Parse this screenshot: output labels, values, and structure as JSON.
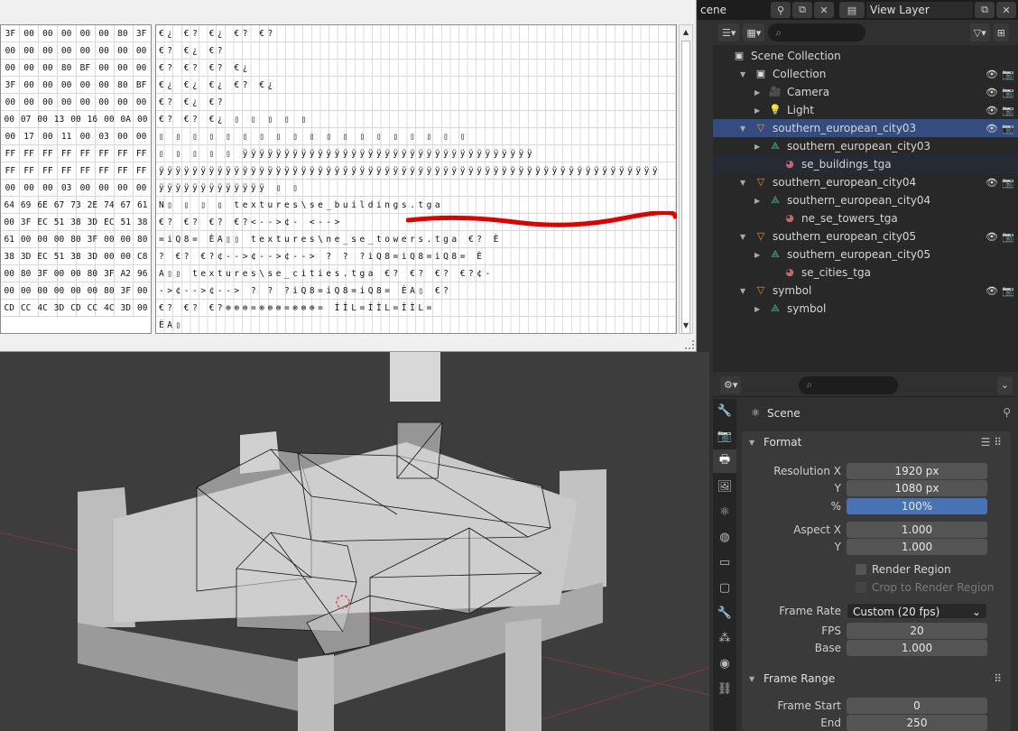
{
  "hex": {
    "byte_rows": [
      [
        "3F",
        "00",
        "00",
        "00",
        "00",
        "00",
        "80",
        "3F"
      ],
      [
        "00",
        "00",
        "00",
        "00",
        "00",
        "00",
        "00",
        "00"
      ],
      [
        "00",
        "00",
        "00",
        "80",
        "BF",
        "00",
        "00",
        "00"
      ],
      [
        "3F",
        "00",
        "00",
        "00",
        "00",
        "00",
        "80",
        "BF"
      ],
      [
        "00",
        "00",
        "00",
        "00",
        "00",
        "00",
        "00",
        "00"
      ],
      [
        "00",
        "07",
        "00",
        "13",
        "00",
        "16",
        "00",
        "0A",
        "00"
      ],
      [
        "00",
        "17",
        "00",
        "11",
        "00",
        "03",
        "00",
        "00"
      ],
      [
        "FF",
        "FF",
        "FF",
        "FF",
        "FF",
        "FF",
        "FF",
        "FF"
      ],
      [
        "FF",
        "FF",
        "FF",
        "FF",
        "FF",
        "FF",
        "FF",
        "FF"
      ],
      [
        "00",
        "00",
        "00",
        "03",
        "00",
        "00",
        "00",
        "00"
      ],
      [
        "64",
        "69",
        "6E",
        "67",
        "73",
        "2E",
        "74",
        "67",
        "61"
      ],
      [
        "00",
        "3F",
        "EC",
        "51",
        "38",
        "3D",
        "EC",
        "51",
        "38"
      ],
      [
        "61",
        "00",
        "00",
        "00",
        "80",
        "3F",
        "00",
        "00",
        "80"
      ],
      [
        "38",
        "3D",
        "EC",
        "51",
        "38",
        "3D",
        "00",
        "00",
        "C8"
      ],
      [
        "00",
        "80",
        "3F",
        "00",
        "00",
        "80",
        "3F",
        "A2",
        "96"
      ],
      [
        "00",
        "00",
        "00",
        "00",
        "00",
        "00",
        "80",
        "3F",
        "00"
      ],
      [
        "CD",
        "CC",
        "4C",
        "3D",
        "CD",
        "CC",
        "4C",
        "3D",
        "00"
      ]
    ],
    "char_rows": [
      "  €¿         €?                         €¿          €?       €?",
      "                          €?         €¿       €?",
      "        €?         €?         €?                            €¿",
      "  €¿         €¿                         €¿          €?       €¿",
      "                          €?         €¿       €?",
      "        €?         €?         €¿    ▯    ▯    ▯    ▯    ▯",
      "▯ ▯  ▯  ▯  ▯  ▯  ▯   ▯  ▯  ▯  ▯  ▯  ▯  ▯  ▯  ▯  ▯  ▯  ▯",
      "▯  ▯  ▯  ▯  ▯   ÿÿÿÿÿÿÿÿÿÿÿÿÿÿÿÿÿÿÿÿÿÿÿÿÿÿÿÿÿÿÿÿÿÿÿ",
      "ÿÿÿÿÿÿÿÿÿÿÿÿÿÿÿÿÿÿÿÿÿÿÿÿÿÿÿÿÿÿÿÿÿÿÿÿÿÿÿÿÿÿÿÿÿÿÿÿÿÿÿÿÿÿÿÿÿÿÿÿ",
      "ÿÿÿÿÿÿÿÿÿÿÿÿÿ                    ▯                    ▯",
      "         N▯    ▯     ▯    ▯       textures\\se_buildings.tga",
      "    €?     €?     €?     €?<-->¢-                           <-->",
      "=iQ8=      ÈA▯▯      textures\\ne_se_towers.tga         €?    È",
      "?    €?     €?¢-->¢-->¢-->     ?     ?    ?iQ8=iQ8=iQ8=    È",
      "A▯▯       textures\\se_cities.tga      €?   €?    €?   €?¢-",
      "->¢-->¢-->      ?         ?       ?iQ8=iQ8=iQ8=     ÈA▯       €?",
      "  €?     €?     €?⊚⊚⊚=⊚⊚⊚=⊚⊚⊚=                          ÍÌL=ÍÌL=ÍÌL=",
      "  ÈA▯"
    ]
  },
  "topbar": {
    "scene_label": "cene",
    "viewlayer_label": "View Layer"
  },
  "outliner": {
    "search_placeholder": "",
    "scene_collection": "Scene Collection",
    "rows": [
      {
        "label": "Collection",
        "depth": 1,
        "type": "collection"
      },
      {
        "label": "Camera",
        "depth": 2,
        "type": "camera"
      },
      {
        "label": "Light",
        "depth": 2,
        "type": "light"
      },
      {
        "label": "southern_european_city03",
        "depth": 1,
        "type": "object",
        "active": true
      },
      {
        "label": "southern_european_city03",
        "depth": 2,
        "type": "mesh"
      },
      {
        "label": "se_buildings_tga",
        "depth": 3,
        "type": "material",
        "selected": true
      },
      {
        "label": "southern_european_city04",
        "depth": 1,
        "type": "object"
      },
      {
        "label": "southern_european_city04",
        "depth": 2,
        "type": "mesh"
      },
      {
        "label": "ne_se_towers_tga",
        "depth": 3,
        "type": "material"
      },
      {
        "label": "southern_european_city05",
        "depth": 1,
        "type": "object"
      },
      {
        "label": "southern_european_city05",
        "depth": 2,
        "type": "mesh"
      },
      {
        "label": "se_cities_tga",
        "depth": 3,
        "type": "material"
      },
      {
        "label": "symbol",
        "depth": 1,
        "type": "object"
      },
      {
        "label": "symbol",
        "depth": 2,
        "type": "mesh"
      }
    ]
  },
  "properties": {
    "context": "Scene",
    "format_title": "Format",
    "resolution_x_label": "Resolution X",
    "resolution_x": "1920 px",
    "resolution_y_label": "Y",
    "resolution_y": "1080 px",
    "percent_label": "%",
    "percent": "100%",
    "percent_level": 1.0,
    "aspect_x_label": "Aspect X",
    "aspect_x": "1.000",
    "aspect_y_label": "Y",
    "aspect_y": "1.000",
    "render_region": "Render Region",
    "crop_region": "Crop to Render Region",
    "frame_rate_label": "Frame Rate",
    "frame_rate": "Custom (20 fps)",
    "fps_label": "FPS",
    "fps": "20",
    "base_label": "Base",
    "base": "1.000",
    "frame_range_title": "Frame Range",
    "frame_start_label": "Frame Start",
    "frame_start": "0",
    "end_label": "End",
    "end": "250"
  },
  "colors": {
    "accent": "#4772b3",
    "active_row": "#334d80",
    "mesh_icon": "#39c1a2",
    "object_icon": "#e8943a"
  }
}
